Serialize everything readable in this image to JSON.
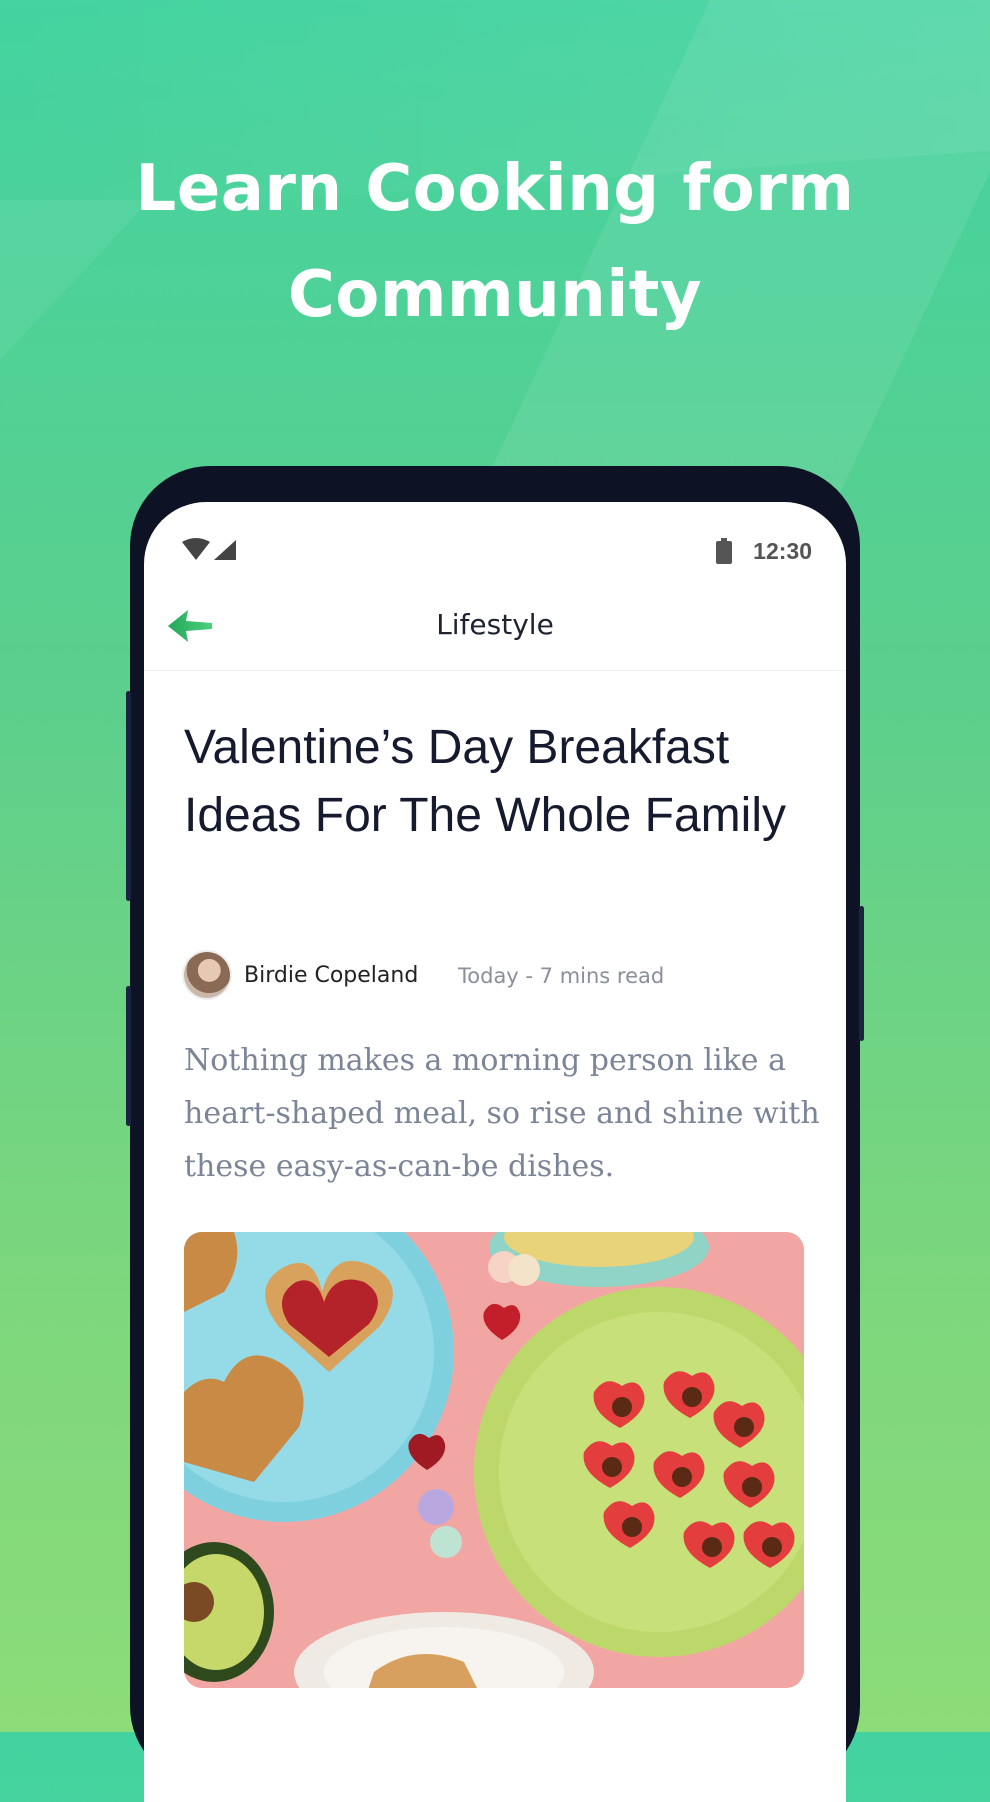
{
  "promo": {
    "line1": "Learn Cooking form",
    "line2": "Community"
  },
  "status_bar": {
    "time": "12:30",
    "icons": [
      "wifi-icon",
      "cell-signal-icon",
      "battery-icon"
    ]
  },
  "app_bar": {
    "title": "Lifestyle",
    "back_icon": "back-arrow-icon"
  },
  "article": {
    "title": "Valentine’s Day Breakfast Ideas For The Whole Family",
    "author": "Birdie Copeland",
    "meta": "Today - 7 mins read",
    "lead": "Nothing makes a morning person like a heart-shaped meal, so rise and shine with these easy-as-can-be dishes."
  },
  "colors": {
    "accent": "#2fb36a",
    "background_top": "#43d3a0",
    "background_bottom": "#8cdc79"
  }
}
